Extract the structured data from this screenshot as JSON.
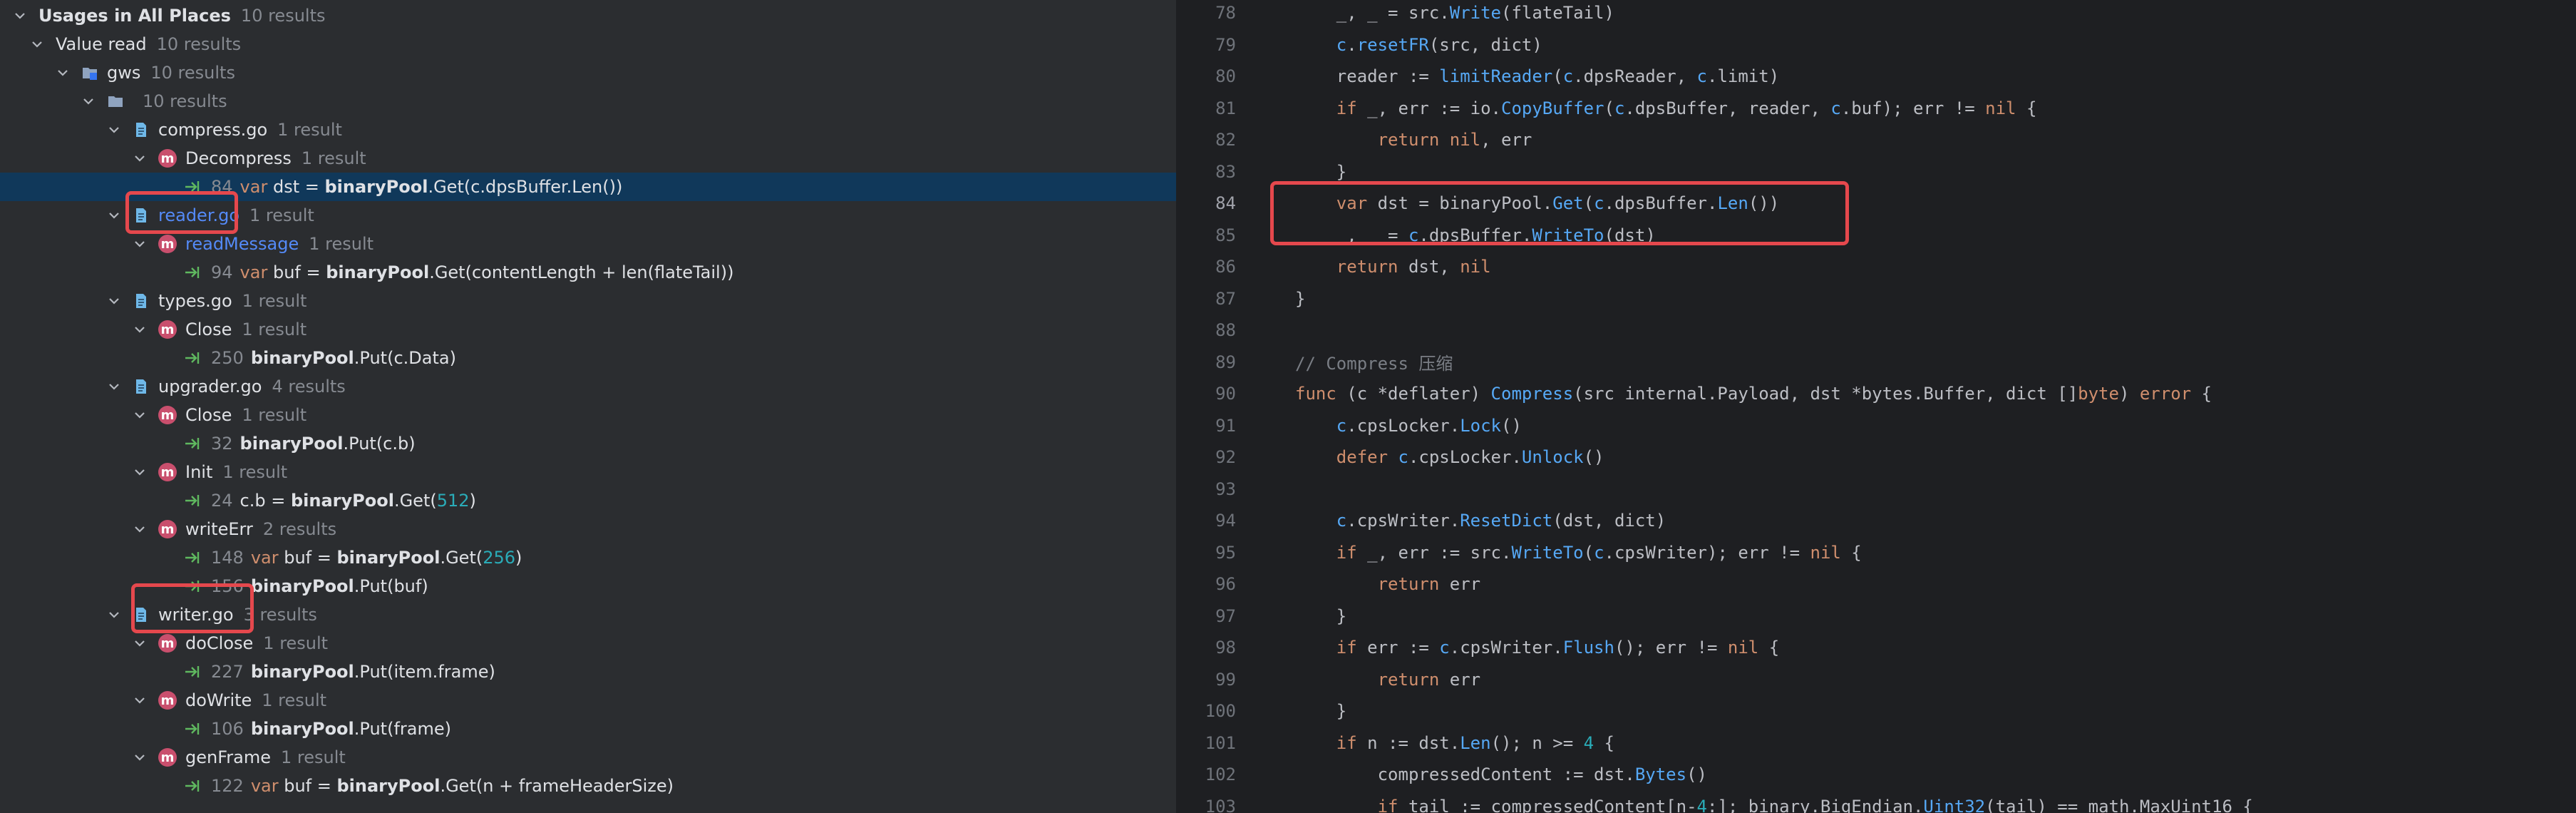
{
  "usages": {
    "header": {
      "title": "Usages in All Places",
      "count": "10 results"
    },
    "nodes": [
      {
        "kind": "group",
        "label": "Value read",
        "count": "10 results"
      },
      {
        "kind": "module",
        "label": "gws",
        "count": "10 results"
      },
      {
        "kind": "dir",
        "label": "",
        "count": "10 results"
      },
      {
        "kind": "file",
        "label": "compress.go",
        "count": "1 result"
      },
      {
        "kind": "method",
        "label": "Decompress",
        "count": "1 result"
      },
      {
        "kind": "usage",
        "line": "84",
        "pre": "var",
        "mid": " dst = ",
        "bold": "binaryPool",
        "post": ".Get(c.dpsBuffer.Len())"
      },
      {
        "kind": "file",
        "label": "reader.go",
        "count": "1 result"
      },
      {
        "kind": "method",
        "label": "readMessage",
        "count": "1 result"
      },
      {
        "kind": "usage",
        "line": "94",
        "pre": "var",
        "mid": " buf = ",
        "bold": "binaryPool",
        "post": ".Get(contentLength + len(flateTail))"
      },
      {
        "kind": "file",
        "label": "types.go",
        "count": "1 result"
      },
      {
        "kind": "method",
        "label": "Close",
        "count": "1 result"
      },
      {
        "kind": "usage",
        "line": "250",
        "pre": "",
        "mid": "",
        "bold": "binaryPool",
        "post": ".Put(c.Data)"
      },
      {
        "kind": "file",
        "label": "upgrader.go",
        "count": "4 results"
      },
      {
        "kind": "method",
        "label": "Close",
        "count": "1 result"
      },
      {
        "kind": "usage",
        "line": "32",
        "pre": "",
        "mid": "",
        "bold": "binaryPool",
        "post": ".Put(c.b)"
      },
      {
        "kind": "method",
        "label": "Init",
        "count": "1 result"
      },
      {
        "kind": "usage",
        "line": "24",
        "pre": "",
        "mid": "c.b = ",
        "bold": "binaryPool",
        "post": ".Get(",
        "num": "512",
        "tail": ")"
      },
      {
        "kind": "method",
        "label": "writeErr",
        "count": "2 results"
      },
      {
        "kind": "usage",
        "line": "148",
        "pre": "var",
        "mid": " buf = ",
        "bold": "binaryPool",
        "post": ".Get(",
        "num": "256",
        "tail": ")"
      },
      {
        "kind": "usage",
        "line": "156",
        "pre": "",
        "mid": "",
        "bold": "binaryPool",
        "post": ".Put(buf)"
      },
      {
        "kind": "file",
        "label": "writer.go",
        "count": "3 results"
      },
      {
        "kind": "method",
        "label": "doClose",
        "count": "1 result"
      },
      {
        "kind": "usage",
        "line": "227",
        "pre": "",
        "mid": "",
        "bold": "binaryPool",
        "post": ".Put(item.frame)"
      },
      {
        "kind": "method",
        "label": "doWrite",
        "count": "1 result"
      },
      {
        "kind": "usage",
        "line": "106",
        "pre": "",
        "mid": "",
        "bold": "binaryPool",
        "post": ".Put(frame)"
      },
      {
        "kind": "method",
        "label": "genFrame",
        "count": "1 result"
      },
      {
        "kind": "usage",
        "line": "122",
        "pre": "var",
        "mid": " buf = ",
        "bold": "binaryPool",
        "post": ".Get(n + frameHeaderSize)"
      }
    ]
  },
  "editor": {
    "lines": [
      {
        "n": "78",
        "code": "    _, _ = src.Write(flateTail)"
      },
      {
        "n": "79",
        "code": "    c.resetFR(src, dict)"
      },
      {
        "n": "80",
        "code": "    reader := limitReader(c.dpsReader, c.limit)"
      },
      {
        "n": "81",
        "code": "    if _, err := io.CopyBuffer(c.dpsBuffer, reader, c.buf); err != nil {"
      },
      {
        "n": "82",
        "code": "        return nil, err"
      },
      {
        "n": "83",
        "code": "    }"
      },
      {
        "n": "84",
        "code": "    var dst = binaryPool.Get(c.dpsBuffer.Len())"
      },
      {
        "n": "85",
        "code": "    _, _ = c.dpsBuffer.WriteTo(dst)"
      },
      {
        "n": "86",
        "code": "    return dst, nil"
      },
      {
        "n": "87",
        "code": "}"
      },
      {
        "n": "88",
        "code": ""
      },
      {
        "n": "89",
        "code": "// Compress 压缩"
      },
      {
        "n": "90",
        "code": "func (c *deflater) Compress(src internal.Payload, dst *bytes.Buffer, dict []byte) error {"
      },
      {
        "n": "91",
        "code": "    c.cpsLocker.Lock()"
      },
      {
        "n": "92",
        "code": "    defer c.cpsLocker.Unlock()"
      },
      {
        "n": "93",
        "code": ""
      },
      {
        "n": "94",
        "code": "    c.cpsWriter.ResetDict(dst, dict)"
      },
      {
        "n": "95",
        "code": "    if _, err := src.WriteTo(c.cpsWriter); err != nil {"
      },
      {
        "n": "96",
        "code": "        return err"
      },
      {
        "n": "97",
        "code": "    }"
      },
      {
        "n": "98",
        "code": "    if err := c.cpsWriter.Flush(); err != nil {"
      },
      {
        "n": "99",
        "code": "        return err"
      },
      {
        "n": "100",
        "code": "    }"
      },
      {
        "n": "101",
        "code": "    if n := dst.Len(); n >= 4 {"
      },
      {
        "n": "102",
        "code": "        compressedContent := dst.Bytes()"
      },
      {
        "n": "103",
        "code": "        if tail := compressedContent[n-4:]; binary.BigEndian.Uint32(tail) == math.MaxUint16 {"
      }
    ]
  },
  "colors": {
    "selection": "#10385a",
    "highlight_border": "#e5484d",
    "method_icon": "#c94f6d",
    "file_link": "#548af7"
  }
}
